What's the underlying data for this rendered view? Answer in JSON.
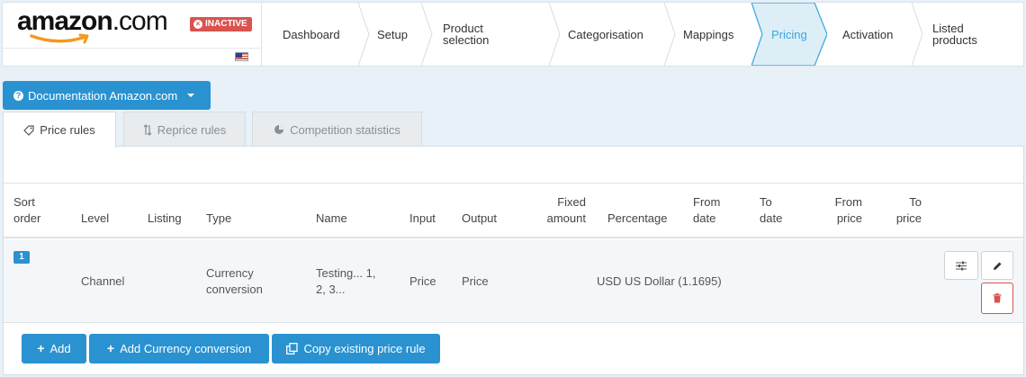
{
  "brand": {
    "logo_main": "amazon",
    "logo_suffix": ".com",
    "status_badge": "INACTIVE",
    "flag_icon": "us-flag-icon"
  },
  "wizard": {
    "steps": [
      {
        "label": "Dashboard",
        "active": false
      },
      {
        "label": "Setup",
        "active": false
      },
      {
        "label": "Product selection",
        "label_line1": "Product",
        "label_line2": "selection",
        "active": false
      },
      {
        "label": "Categorisation",
        "active": false
      },
      {
        "label": "Mappings",
        "active": false
      },
      {
        "label": "Pricing",
        "active": true
      },
      {
        "label": "Activation",
        "active": false
      },
      {
        "label": "Listed products",
        "label_line1": "Listed",
        "label_line2": "products",
        "active": false
      }
    ]
  },
  "documentation_button": {
    "label": "Documentation Amazon.com",
    "icon": "question-circle-icon"
  },
  "tabs": [
    {
      "label": "Price rules",
      "icon": "tag-icon",
      "active": true
    },
    {
      "label": "Reprice rules",
      "icon": "sort-arrows-icon",
      "active": false
    },
    {
      "label": "Competition statistics",
      "icon": "pie-chart-icon",
      "active": false
    }
  ],
  "table": {
    "columns": {
      "sort_order": [
        "Sort",
        "order"
      ],
      "level": "Level",
      "listing": "Listing",
      "type": "Type",
      "name": "Name",
      "input": "Input",
      "output": "Output",
      "fixed_amount": [
        "Fixed",
        "amount"
      ],
      "percentage": "Percentage",
      "from_date": [
        "From",
        "date"
      ],
      "to_date": [
        "To",
        "date"
      ],
      "from_price": [
        "From",
        "price"
      ],
      "to_price": [
        "To",
        "price"
      ]
    },
    "rows": [
      {
        "sort_order": "1",
        "level": "Channel",
        "listing": "",
        "type": [
          "Currency",
          "conversion"
        ],
        "name": [
          "Testing... 1,",
          "2, 3..."
        ],
        "input": "Price",
        "output": "Price",
        "fixed_amount": "",
        "percentage": "USD US Dollar (1.1695)",
        "actions": [
          "sliders-icon",
          "pencil-icon",
          "trash-icon"
        ]
      }
    ]
  },
  "footer_buttons": {
    "add": "Add",
    "add_currency": "Add Currency conversion",
    "copy_rule": "Copy existing price rule"
  },
  "colors": {
    "primary": "#2a92d0",
    "danger": "#d9534f",
    "active_step": "#3aa6dd",
    "background": "#e7f1f7"
  }
}
